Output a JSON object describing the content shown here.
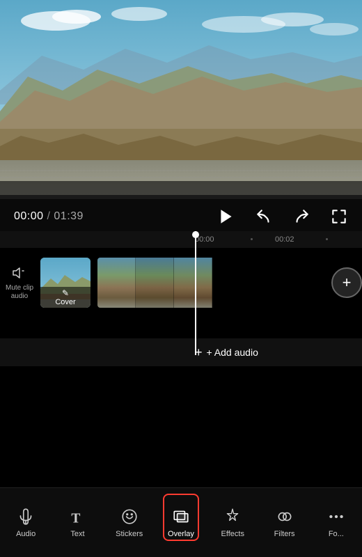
{
  "video": {
    "current_time": "00:00",
    "total_time": "01:39",
    "separator": "/"
  },
  "timeline": {
    "marker_start": "00:00",
    "marker_end": "00:02"
  },
  "tracks": {
    "mute_clip": {
      "label_line1": "Mute clip",
      "label_line2": "audio"
    },
    "cover": {
      "label": "Cover"
    },
    "add_audio": "+ Add audio"
  },
  "toolbar": {
    "items": [
      {
        "id": "audio",
        "label": "Audio",
        "icon": "audio"
      },
      {
        "id": "text",
        "label": "Text",
        "icon": "text"
      },
      {
        "id": "stickers",
        "label": "Stickers",
        "icon": "stickers"
      },
      {
        "id": "overlay",
        "label": "Overlay",
        "icon": "overlay",
        "active": true
      },
      {
        "id": "effects",
        "label": "Effects",
        "icon": "effects"
      },
      {
        "id": "filters",
        "label": "Filters",
        "icon": "filters"
      },
      {
        "id": "more",
        "label": "Fo...",
        "icon": "more"
      }
    ]
  }
}
